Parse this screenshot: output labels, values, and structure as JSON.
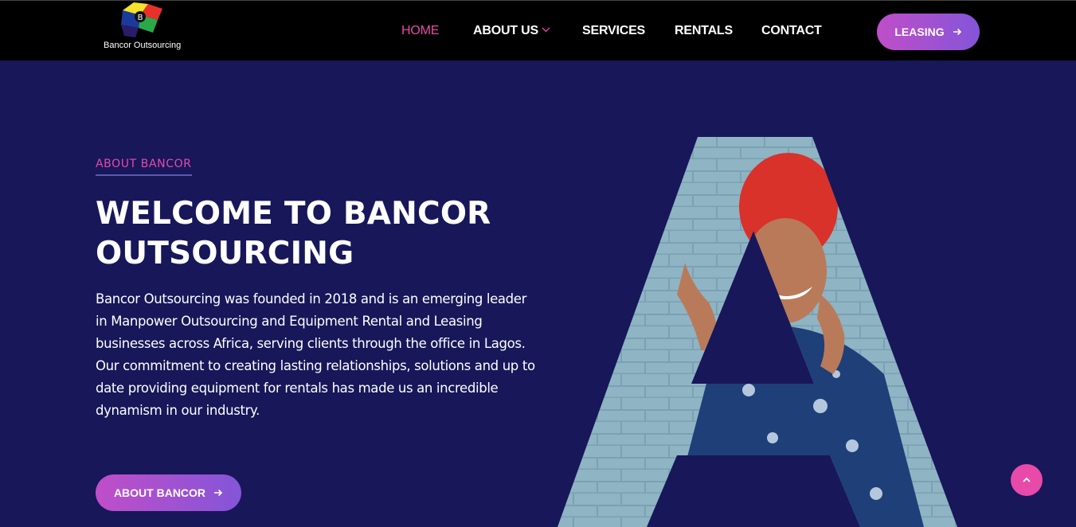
{
  "brand": {
    "name": "Bancor Outsourcing",
    "logo_icon": "bancor-logo-icon",
    "logo_letter": "B"
  },
  "nav": {
    "items": [
      {
        "label": "HOME",
        "active": true
      },
      {
        "label": "ABOUT US",
        "has_dropdown": true
      },
      {
        "label": "SERVICES"
      },
      {
        "label": "RENTALS"
      },
      {
        "label": "CONTACT"
      }
    ],
    "cta_label": "LEASING",
    "cta_icon": "arrow-right-icon"
  },
  "hero": {
    "eyebrow": "ABOUT BANCOR",
    "title_line1": "WELCOME TO BANCOR",
    "title_line2": "OUTSOURCING",
    "body": "Bancor Outsourcing was founded in 2018 and is an emerging leader in Manpower Outsourcing and Equipment Rental and Leasing businesses across Africa, serving clients through the office in Lagos. Our commitment to creating lasting relationships, solutions and up to date providing equipment for rentals has made us an incredible dynamism in our industry.",
    "button_label": "ABOUT BANCOR",
    "button_icon": "arrow-right-icon",
    "image": "letter-a-photo-woman-smiling"
  },
  "scroll_top": {
    "icon": "chevron-up-icon"
  },
  "colors": {
    "background": "#17175a",
    "topbar": "#000000",
    "accent_pink": "#e84aa9",
    "button_gradient_start": "#c04ec9",
    "button_gradient_end": "#8455d8"
  }
}
